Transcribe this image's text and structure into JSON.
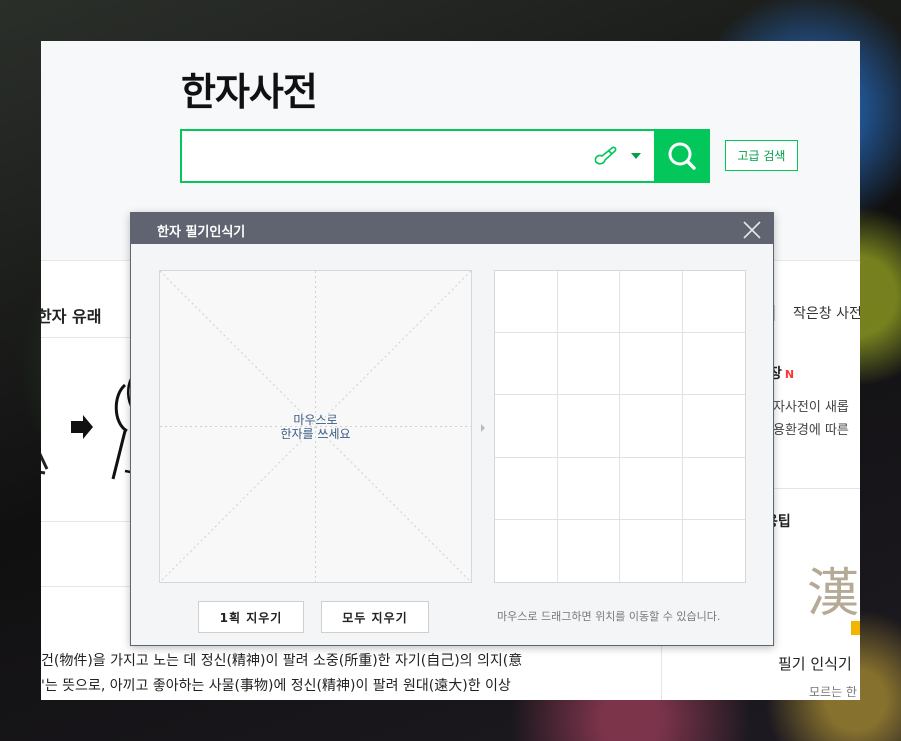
{
  "page": {
    "title": "한자사전",
    "search": {
      "value": "",
      "placeholder": ""
    },
    "advanced_search_label": "고급 검색",
    "section_left_heading": "한자 유래",
    "right_tab_label": "작은창 사전",
    "notice": {
      "title": "장",
      "badge": "N",
      "lines": [
        "자사전이 새롭",
        "용환경에 따른"
      ]
    },
    "tip_title": "용팁",
    "hanja_glyph": "漢",
    "handwriting_caption": "필기 인식기",
    "handwriting_subcaption": "모르는 한",
    "body_lines": [
      "건(物件)을 가지고 노는 데 정신(精神)이 팔려 소중(所重)한 자기(自己)의 의지(意",
      "'는 뜻으로, 아끼고 좋아하는 사물(事物)에 정신(精神)이 팔려 원대(遠大)한 이상"
    ]
  },
  "dialog": {
    "title": "한자 필기인식기",
    "canvas_hint_line1": "마우스로",
    "canvas_hint_line2": "한자를 쓰세요",
    "clear_one_label": "1획 지우기",
    "clear_all_label": "모두 지우기",
    "drag_hint": "마우스로 드래그하면 위치를 이동할 수 있습니다."
  },
  "colors": {
    "brand_green": "#03c75a",
    "dialog_titlebar": "#5f6470",
    "new_badge": "#ff3333"
  },
  "icons": {
    "search": "magnifier-icon",
    "handwriting": "pen-icon",
    "dropdown": "caret-down-icon",
    "close": "close-icon"
  }
}
